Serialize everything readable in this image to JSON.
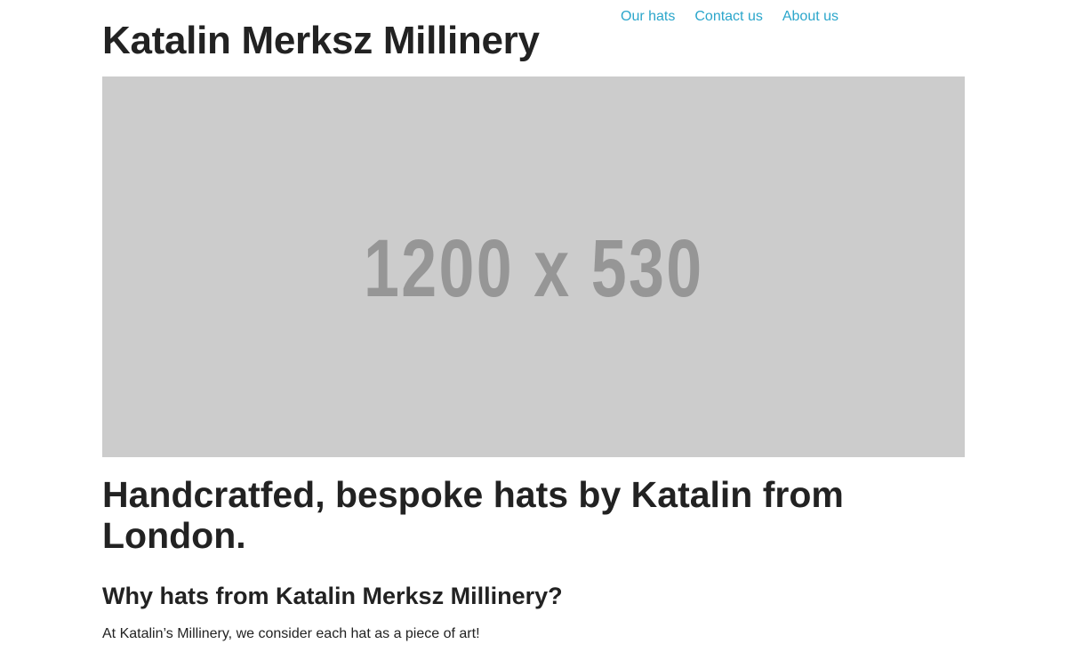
{
  "header": {
    "site_title": "Katalin Merksz Millinery",
    "nav": [
      {
        "label": "Our hats"
      },
      {
        "label": "Contact us"
      },
      {
        "label": "About us"
      }
    ]
  },
  "hero": {
    "placeholder_label": "1200 x 530"
  },
  "main": {
    "headline": "Handcratfed, bespoke hats by Katalin from London.",
    "subheading": "Why hats from Katalin Merksz Millinery?",
    "paragraph": "At Katalin’s Millinery, we consider each hat as a piece of art!"
  },
  "colors": {
    "link": "#2ba6cb",
    "text": "#222222",
    "placeholder_bg": "#cccccc",
    "placeholder_text": "#969696"
  }
}
